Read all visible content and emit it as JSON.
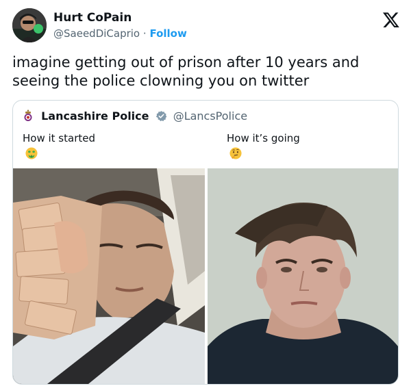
{
  "tweet": {
    "display_name": "Hurt CoPain",
    "handle": "@SaeedDiCaprio",
    "separator": "·",
    "follow_label": "Follow",
    "text": "imagine getting out of prison after 10 years and seeing the police clowning you on twitter"
  },
  "quote": {
    "display_name": "Lancashire Police",
    "handle": "@LancsPolice",
    "left_caption": "How it started",
    "right_caption": "How it’s going",
    "left_emoji": "money-mouth-face-emoji",
    "right_emoji": "thinking-face-emoji"
  },
  "icons": {
    "logo": "x-logo-icon",
    "verified": "verified-badge-icon",
    "crest": "police-crest-icon"
  },
  "colors": {
    "follow": "#1d9bf0",
    "handle": "#536471",
    "border": "#cfd9de",
    "verified": "#829aab"
  }
}
